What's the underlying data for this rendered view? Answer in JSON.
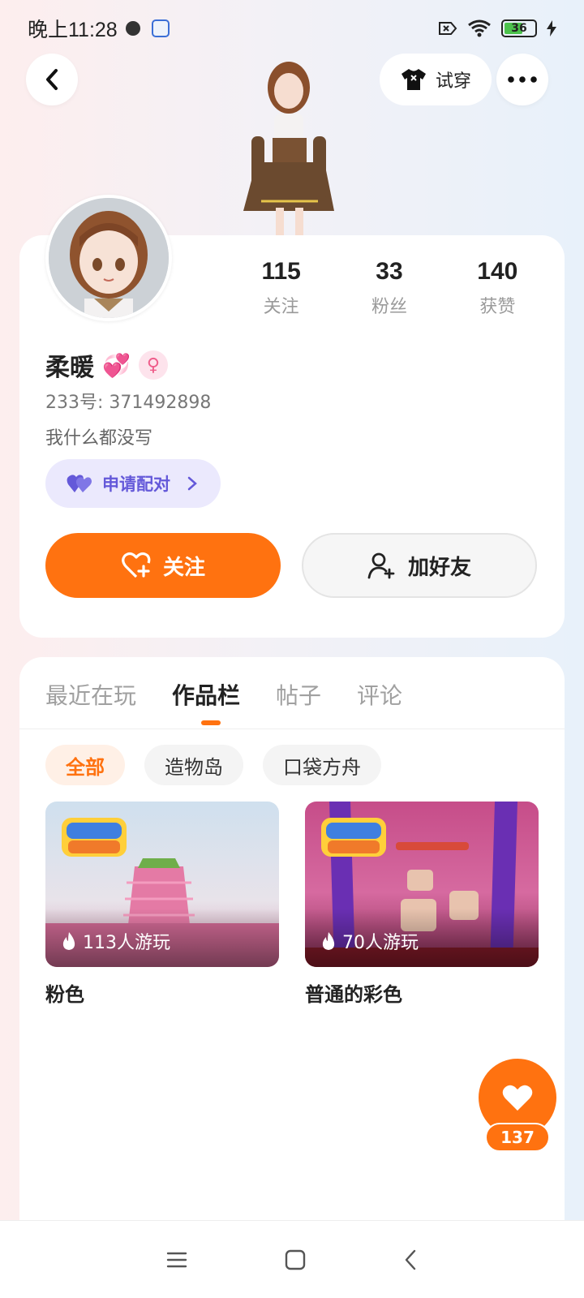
{
  "status_bar": {
    "time": "晚上11:28",
    "battery": "36"
  },
  "header": {
    "back_icon": "chevron-left-icon",
    "tryon_label": "试穿",
    "more_icon": "more-dots-icon"
  },
  "profile": {
    "name": "柔暖",
    "name_emoji": "💞",
    "gender_symbol": "♀",
    "user_id": "233号: 371492898",
    "bio": "我什么都没写",
    "match_label": "申请配对",
    "stats": [
      {
        "value": "115",
        "label": "关注"
      },
      {
        "value": "33",
        "label": "粉丝"
      },
      {
        "value": "140",
        "label": "获赞"
      }
    ],
    "follow_label": "关注",
    "add_friend_label": "加好友"
  },
  "tabs": [
    {
      "label": "最近在玩",
      "active": false
    },
    {
      "label": "作品栏",
      "active": true
    },
    {
      "label": "帖子",
      "active": false
    },
    {
      "label": "评论",
      "active": false
    }
  ],
  "chips": [
    {
      "label": "全部",
      "active": true
    },
    {
      "label": "造物岛",
      "active": false
    },
    {
      "label": "口袋方舟",
      "active": false
    }
  ],
  "works": [
    {
      "title": "粉色",
      "plays": "113人游玩"
    },
    {
      "title": "普通的彩色",
      "plays": "70人游玩"
    }
  ],
  "like": {
    "count": "137"
  },
  "colors": {
    "accent": "#ff7210",
    "match_bg": "#ebe9fd",
    "match_text": "#6459d9"
  }
}
